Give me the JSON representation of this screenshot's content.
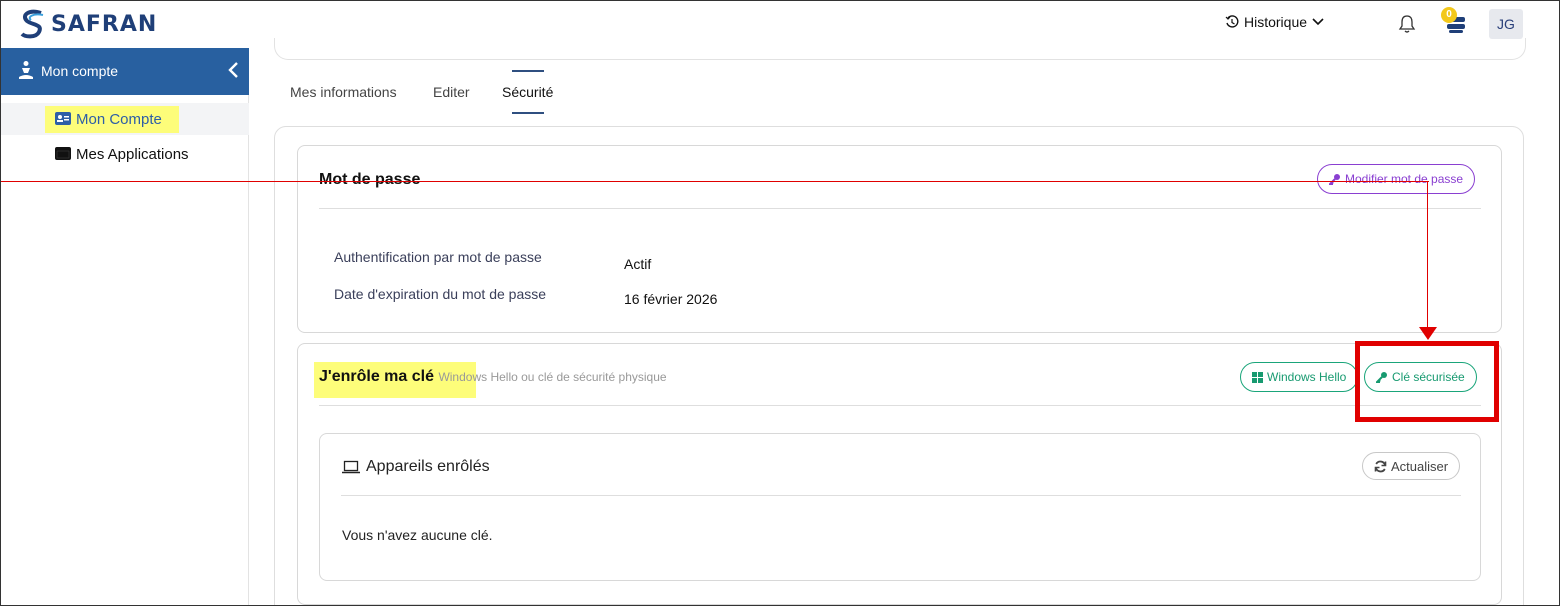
{
  "header": {
    "logo_text": "SAFRAN",
    "history_label": "Historique",
    "notification_count": "0",
    "avatar_initials": "JG"
  },
  "sidebar": {
    "title": "Mon compte",
    "items": [
      {
        "label": "Mon Compte",
        "active": true
      },
      {
        "label": "Mes Applications",
        "active": false
      }
    ]
  },
  "tabs": [
    {
      "label": "Mes informations"
    },
    {
      "label": "Editer"
    },
    {
      "label": "Sécurité",
      "active": true
    }
  ],
  "password_card": {
    "title": "Mot de passe",
    "modify_button": "Modifier mot de passe",
    "rows": [
      {
        "label": "Authentification par mot de passe",
        "value": "Actif"
      },
      {
        "label": "Date d'expiration du mot de passe",
        "value": "16 février 2026"
      }
    ]
  },
  "enroll_card": {
    "title": "J'enrôle ma clé",
    "subtitle": "Windows Hello ou clé de sécurité physique",
    "windows_hello_button": "Windows Hello",
    "security_key_button": "Clé sécurisée",
    "devices": {
      "title": "Appareils enrôlés",
      "refresh_button": "Actualiser",
      "empty_message": "Vous n'avez aucune clé."
    }
  },
  "colors": {
    "brand": "#1f3f78",
    "sidebar_header": "#2860a0",
    "highlight": "#fdfd7a",
    "purple": "#8a3fd1",
    "green": "#1aa57a",
    "annotation_red": "#e00000"
  }
}
